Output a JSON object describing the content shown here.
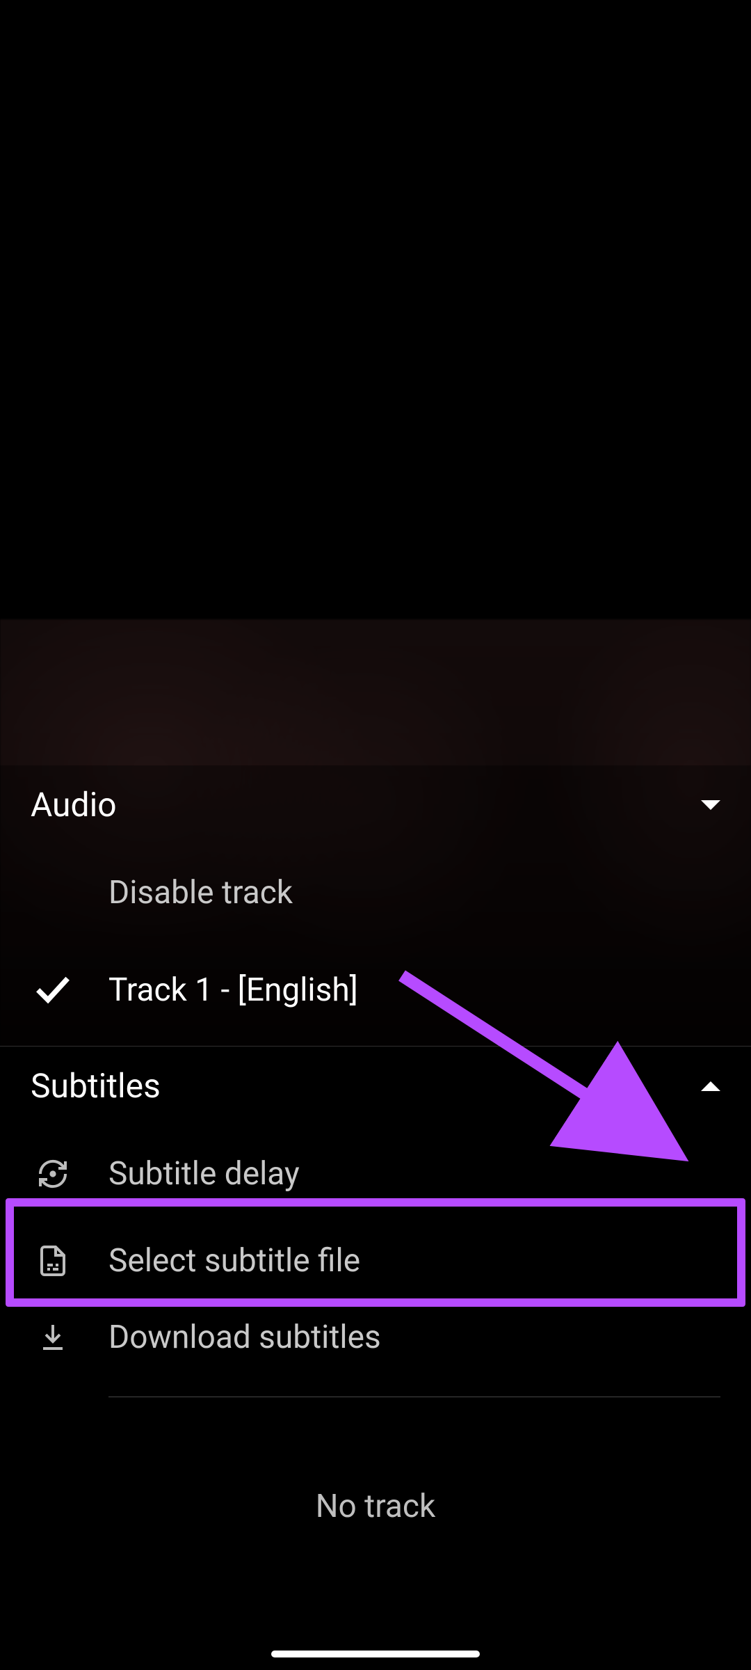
{
  "accent": "#b64bff",
  "audio": {
    "header": "Audio",
    "expanded": false,
    "options": {
      "disable": "Disable track",
      "track1": "Track 1 - [English]",
      "selected": "track1"
    }
  },
  "subtitles": {
    "header": "Subtitles",
    "expanded": true,
    "actions": {
      "delay": "Subtitle delay",
      "select_file": "Select subtitle file",
      "download": "Download subtitles"
    },
    "current_track": "No track"
  },
  "icons": {
    "check": "check-icon",
    "sync": "sync-icon",
    "file": "file-text-icon",
    "download": "download-icon",
    "chevron_down": "chevron-down-icon",
    "chevron_up": "chevron-up-icon"
  }
}
